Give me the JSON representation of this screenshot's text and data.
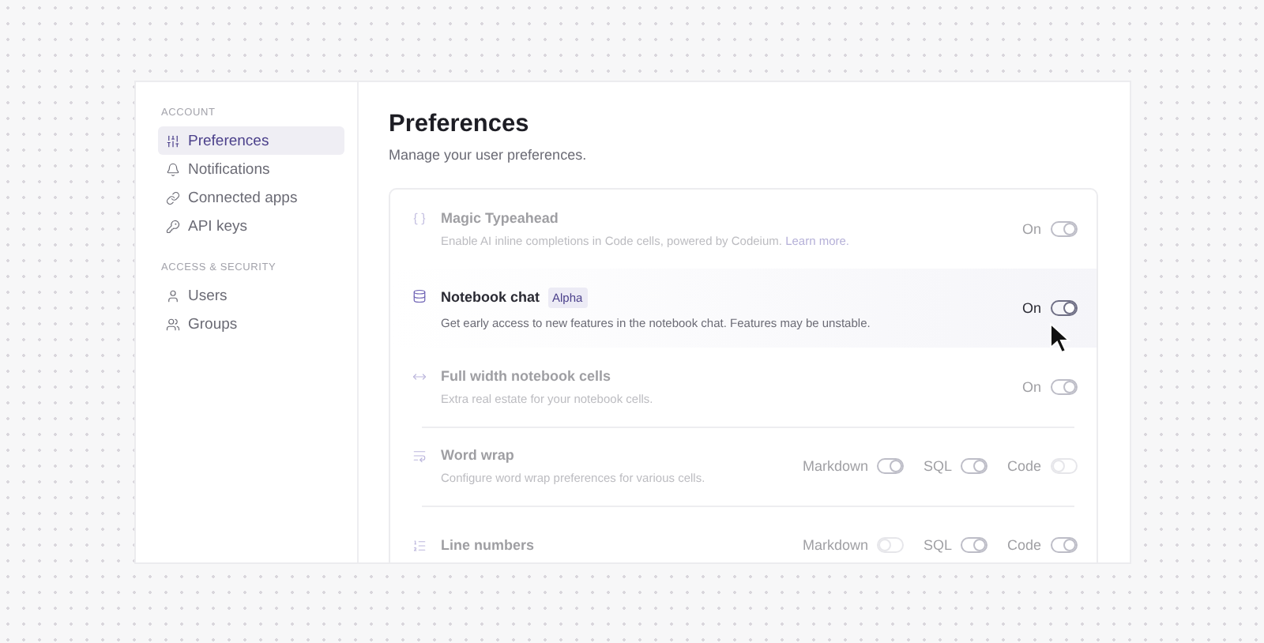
{
  "sidebar": {
    "sections": [
      {
        "heading": "ACCOUNT",
        "items": [
          {
            "label": "Preferences",
            "selected": true
          },
          {
            "label": "Notifications",
            "selected": false
          },
          {
            "label": "Connected apps",
            "selected": false
          },
          {
            "label": "API keys",
            "selected": false
          }
        ]
      },
      {
        "heading": "ACCESS & SECURITY",
        "items": [
          {
            "label": "Users",
            "selected": false
          },
          {
            "label": "Groups",
            "selected": false
          }
        ]
      }
    ]
  },
  "page": {
    "title": "Preferences",
    "subtitle": "Manage your user preferences."
  },
  "settings": [
    {
      "title": "Magic Typeahead",
      "description": "Enable AI inline completions in Code cells, powered by Codeium.",
      "link": "Learn more.",
      "highlighted": false,
      "controls": [
        {
          "label": "On",
          "on": true
        }
      ]
    },
    {
      "title": "Notebook chat",
      "badge": "Alpha",
      "description": "Get early access to new features in the notebook chat. Features may be unstable.",
      "highlighted": true,
      "controls": [
        {
          "label": "On",
          "on": true
        }
      ]
    },
    {
      "title": "Full width notebook cells",
      "description": "Extra real estate for your notebook cells.",
      "highlighted": false,
      "controls": [
        {
          "label": "On",
          "on": true
        }
      ]
    },
    {
      "title": "Word wrap",
      "description": "Configure word wrap preferences for various cells.",
      "highlighted": false,
      "controls": [
        {
          "label": "Markdown",
          "on": true
        },
        {
          "label": "SQL",
          "on": true
        },
        {
          "label": "Code",
          "on": false
        }
      ]
    },
    {
      "title": "Line numbers",
      "highlighted": false,
      "controls": [
        {
          "label": "Markdown",
          "on": false
        },
        {
          "label": "SQL",
          "on": true
        },
        {
          "label": "Code",
          "on": true
        }
      ]
    }
  ]
}
